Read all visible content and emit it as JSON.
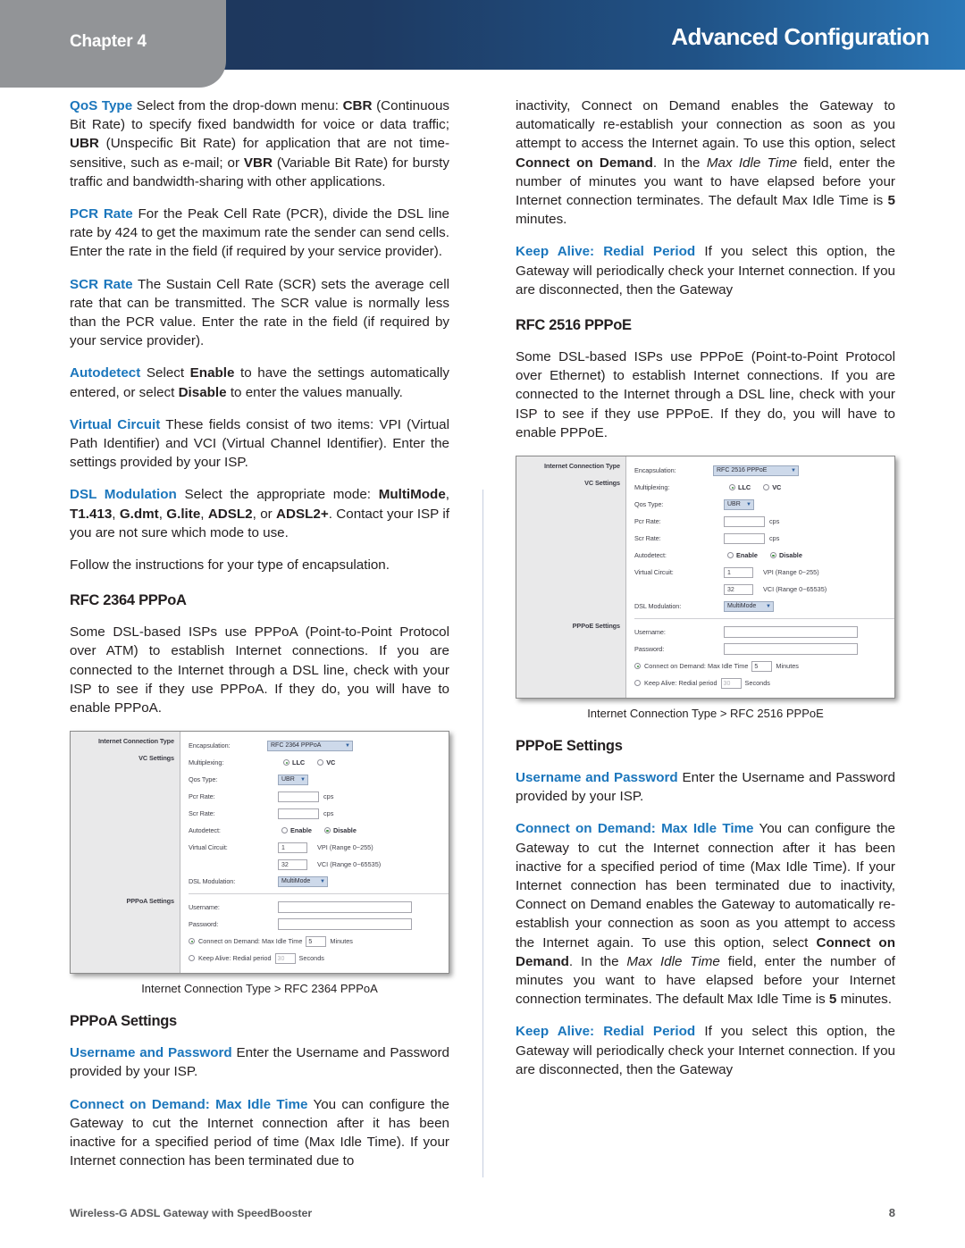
{
  "header": {
    "chapter": "Chapter 4",
    "title": "Advanced Configuration",
    "accent_navy": "#1d3557",
    "accent_blue": "#2b78b8",
    "tab_grey": "#929497"
  },
  "left_column": {
    "p_qos_type": {
      "lead": "QoS Type",
      "t1": " Select from the drop-down menu: ",
      "b1": "CBR",
      "t2": " (Continuous Bit Rate) to specify fixed bandwidth for voice or data traffic; ",
      "b2": "UBR",
      "t3": " (Unspecific Bit Rate) for application that are not time-sensitive, such as e-mail; or ",
      "b3": "VBR",
      "t4": " (Variable Bit Rate) for bursty traffic and bandwidth-sharing with other applications."
    },
    "p_pcr_rate": {
      "lead": "PCR Rate",
      "t1": "  For the Peak Cell Rate (PCR), divide the DSL line rate by 424 to get the maximum rate the sender can send cells. Enter the rate in the field (if required by your service provider)."
    },
    "p_scr_rate": {
      "lead": "SCR Rate",
      "t1": "  The Sustain Cell Rate (SCR) sets the average cell rate that can be transmitted. The SCR value is normally less than the PCR value. Enter the rate in the field (if required by your service provider)."
    },
    "p_autodetect": {
      "lead": "Autodetect",
      "t1": " Select ",
      "b1": "Enable",
      "t2": " to have the settings automatically entered, or select ",
      "b2": "Disable",
      "t3": " to enter the values manually."
    },
    "p_virtual_circuit": {
      "lead": "Virtual Circuit",
      "t1": " These fields consist of two items: VPI (Virtual Path Identifier) and VCI (Virtual Channel Identifier). Enter the settings provided by your ISP."
    },
    "p_dsl_modulation": {
      "lead": "DSL Modulation",
      "t1": " Select the appropriate mode: ",
      "b1": "MultiMode",
      "t2": ", ",
      "b2": "T1.413",
      "t3": ", ",
      "b3": "G.dmt",
      "t4": ", ",
      "b4": "G.lite",
      "t5": ", ",
      "b5": "ADSL2",
      "t6": ", or ",
      "b6": "ADSL2+",
      "t7": ". Contact your ISP if you are not sure which mode to use."
    },
    "p_follow": "Follow the instructions for your type of encapsulation.",
    "h_rfc2364": "RFC 2364 PPPoA",
    "p_rfc2364_body": "Some DSL-based ISPs use PPPoA (Point-to-Point Protocol over ATM) to establish Internet connections. If you are connected to the Internet through a DSL line, check with your ISP to see if they use PPPoA. If they do, you will have to enable PPPoA.",
    "caption_pppoa": "Internet Connection Type > RFC 2364 PPPoA",
    "h_pppoa_settings": "PPPoA Settings",
    "p_username_password": {
      "lead": "Username and Password",
      "t1": " Enter the Username and Password provided by your ISP."
    },
    "p_connect_on_demand": {
      "lead": "Connect on Demand: Max Idle Time",
      "t1": "  You can configure the Gateway to cut the Internet connection after it has been inactive for a specified period of time (Max Idle Time). If your Internet connection has been terminated due to"
    }
  },
  "right_column": {
    "p_inactivity": {
      "t1": "inactivity, Connect on Demand enables the Gateway to automatically re-establish your connection as soon as you attempt to access the Internet again. To use this option, select ",
      "b1": "Connect on Demand",
      "t2": ". In the ",
      "i1": "Max Idle Time",
      "t3": " field, enter the number of minutes you want to have elapsed before your Internet connection terminates. The default Max Idle Time is ",
      "b2": "5",
      "t4": " minutes."
    },
    "p_keep_alive": {
      "lead": "Keep Alive: Redial Period",
      "t1": " If you select this option, the Gateway will periodically check your Internet connection. If you are disconnected, then the Gateway"
    },
    "h_rfc2516": "RFC 2516 PPPoE",
    "p_rfc2516_body": "Some DSL-based ISPs use PPPoE (Point-to-Point Protocol over Ethernet) to establish Internet connections. If you are connected to the Internet through a DSL line, check with your ISP to see if they use PPPoE. If they do, you will have to enable PPPoE.",
    "caption_pppoe": "Internet Connection Type > RFC 2516 PPPoE",
    "h_pppoe_settings": "PPPoE Settings",
    "p_username_password": {
      "lead": "Username and Password",
      "t1": " Enter the Username and Password provided by your ISP."
    },
    "p_connect_on_demand": {
      "lead": "Connect on Demand: Max Idle Time",
      "t1": "  You can configure the Gateway to cut the Internet connection after it has been inactive for a specified period of time (Max Idle Time). If your Internet connection has been terminated due to inactivity, Connect on Demand enables the Gateway to automatically re-establish your connection as soon as you attempt to access the Internet again. To use this option, select ",
      "b1": "Connect on Demand",
      "t2": ". In the ",
      "i1": "Max Idle Time",
      "t3": " field, enter the number of minutes you want to have elapsed before your Internet connection terminates. The default Max Idle Time is ",
      "b2": "5",
      "t4": " minutes."
    }
  },
  "figure_pppoa": {
    "section_internet": "Internet Connection Type",
    "section_vc": "VC Settings",
    "section_proto": "PPPoA Settings",
    "encapsulation_label": "Encapsulation:",
    "encapsulation_value": "RFC 2364 PPPoA",
    "multiplexing_label": "Multiplexing:",
    "multiplexing_llc": "LLC",
    "multiplexing_vc": "VC",
    "qos_label": "Qos Type:",
    "qos_value": "UBR",
    "pcr_label": "Pcr Rate:",
    "pcr_unit": "cps",
    "scr_label": "Scr Rate:",
    "scr_unit": "cps",
    "autodetect_label": "Autodetect:",
    "autodetect_enable": "Enable",
    "autodetect_disable": "Disable",
    "virtual_circuit_label": "Virtual Circuit:",
    "vpi_value": "1",
    "vpi_range": "VPI (Range 0~255)",
    "vci_value": "32",
    "vci_range": "VCI (Range 0~65535)",
    "dsl_label": "DSL Modulation:",
    "dsl_value": "MultiMode",
    "username_label": "Username:",
    "password_label": "Password:",
    "cod_label": "Connect on Demand: Max Idle Time",
    "cod_value": "5",
    "cod_unit": "Minutes",
    "ka_label": "Keep Alive: Redial period",
    "ka_value": "30",
    "ka_unit": "Seconds"
  },
  "figure_pppoe": {
    "section_internet": "Internet Connection Type",
    "section_vc": "VC Settings",
    "section_proto": "PPPoE Settings",
    "encapsulation_label": "Encapsulation:",
    "encapsulation_value": "RFC 2516 PPPoE",
    "multiplexing_label": "Multiplexing:",
    "multiplexing_llc": "LLC",
    "multiplexing_vc": "VC",
    "qos_label": "Qos Type:",
    "qos_value": "UBR",
    "pcr_label": "Pcr Rate:",
    "pcr_unit": "cps",
    "scr_label": "Scr Rate:",
    "scr_unit": "cps",
    "autodetect_label": "Autodetect:",
    "autodetect_enable": "Enable",
    "autodetect_disable": "Disable",
    "virtual_circuit_label": "Virtual Circuit:",
    "vpi_value": "1",
    "vpi_range": "VPI (Range 0~255)",
    "vci_value": "32",
    "vci_range": "VCI (Range 0~65535)",
    "dsl_label": "DSL Modulation:",
    "dsl_value": "MultiMode",
    "username_label": "Username:",
    "password_label": "Password:",
    "cod_label": "Connect on Demand: Max Idle Time",
    "cod_value": "5",
    "cod_unit": "Minutes",
    "ka_label": "Keep Alive: Redial period",
    "ka_value": "30",
    "ka_unit": "Seconds"
  },
  "footer": {
    "product": "Wireless-G ADSL Gateway with SpeedBooster",
    "page_number": "8"
  }
}
